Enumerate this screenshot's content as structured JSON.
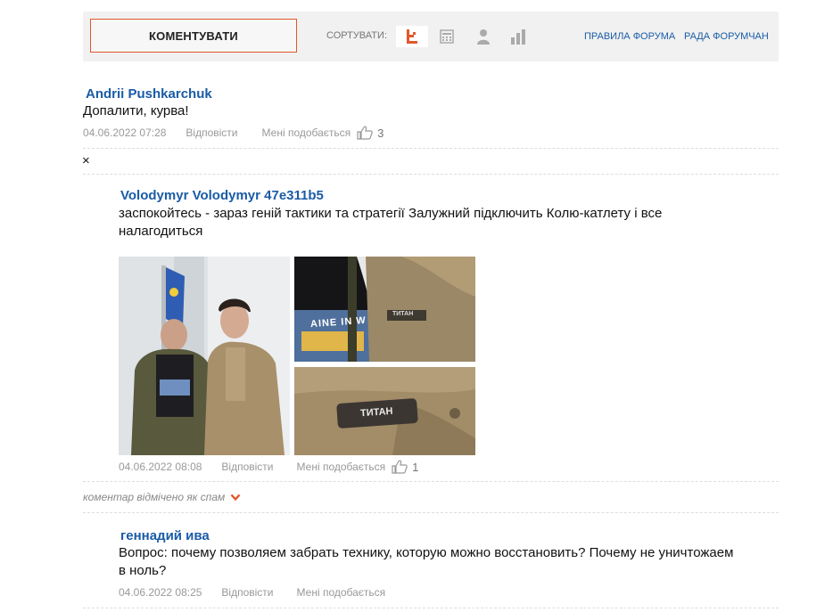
{
  "toolbar": {
    "comment_button": "КОМЕНТУВАТИ",
    "sort_label": "СОРТУВАТИ:",
    "rules_link": "ПРАВИЛА ФОРУМА",
    "council_link": "РАДА ФОРУМЧАН",
    "accent_color": "#e2572b"
  },
  "comments": [
    {
      "author": "Andrii Pushkarchuk",
      "text": "Допалити, курва!",
      "date": "04.06.2022 07:28",
      "reply": "Відповісти",
      "like": "Мені подобається",
      "likes": "3"
    },
    {
      "author": "Volodymyr Volodymyr 47e311b5",
      "text_line1": "заспокойтесь - зараз геній тактики та стратегії Залужний підключить Колю-катлету і все",
      "text_line2": "налагодиться",
      "date": "04.06.2022 08:08",
      "reply": "Відповісти",
      "like": "Мені подобається",
      "likes": "1",
      "photo_patch_text": "ТИТАН",
      "photo_shirt_text": "AINE IN W"
    },
    {
      "author": "геннадий ива",
      "text_line1": "Вопрос: почему позволяем забрать технику, которую можно восстановить? Почему не уничтожаем",
      "text_line2": "в ноль?",
      "date": "04.06.2022 08:25",
      "reply": "Відповісти",
      "like": "Мені подобається"
    }
  ],
  "spam_note": "коментар відмічено як спам",
  "close_symbol": "×"
}
